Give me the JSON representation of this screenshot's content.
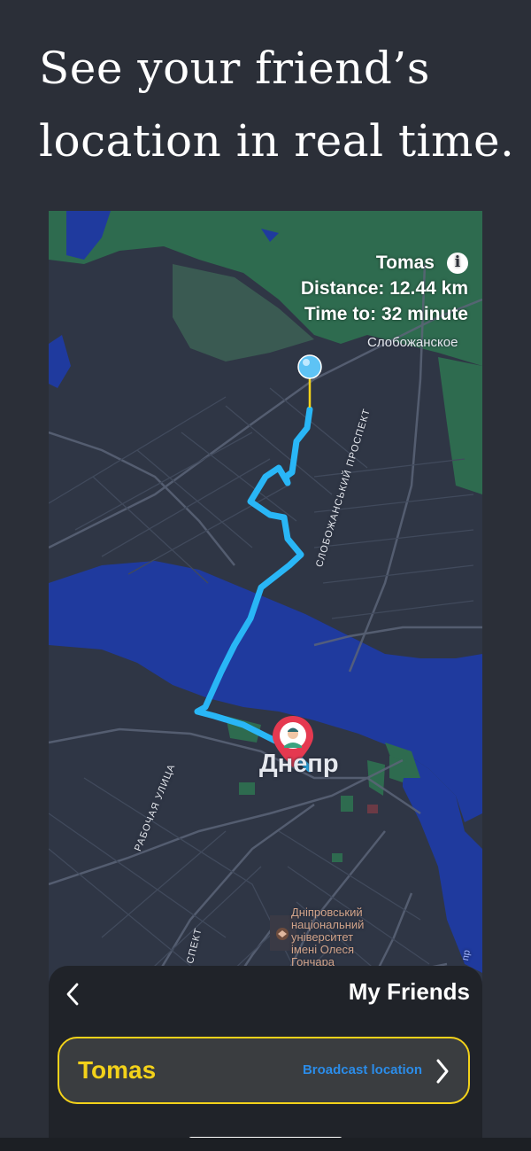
{
  "headline": {
    "line1": "See your friend’s",
    "line2": "location in real time."
  },
  "map": {
    "friend_name": "Tomas",
    "distance": "Distance: 12.44 km",
    "time_to": "Time to: 32 minute",
    "info_icon_glyph": "i",
    "labels": {
      "slobozhanskoe": "Слобожанское",
      "city": "Днепр",
      "prospect": "СЛОБОЖАНСЬКИЙ ПРОСПЕКТ",
      "street": "РАБОЧАЯ УЛИЦА",
      "university": [
        "Дніпровський",
        "національний",
        "університет",
        "імені Олеся",
        "Гончара"
      ],
      "prospect_bottom": "СПЕКТ",
      "edge_text": "пр"
    }
  },
  "sheet": {
    "title": "My Friends",
    "friend": {
      "name": "Tomas",
      "action": "Broadcast location"
    }
  },
  "colors": {
    "route": "#29b6f6",
    "accent_yellow": "#f3d21a",
    "broadcast_blue": "#2b8ce8",
    "pin_red": "#e53950",
    "river": "#1f3a9e",
    "forest": "#2e6b4f"
  },
  "icons": [
    "info-icon",
    "back-chevron-icon",
    "chevron-right-icon",
    "location-pin-icon",
    "blue-pin-icon"
  ]
}
